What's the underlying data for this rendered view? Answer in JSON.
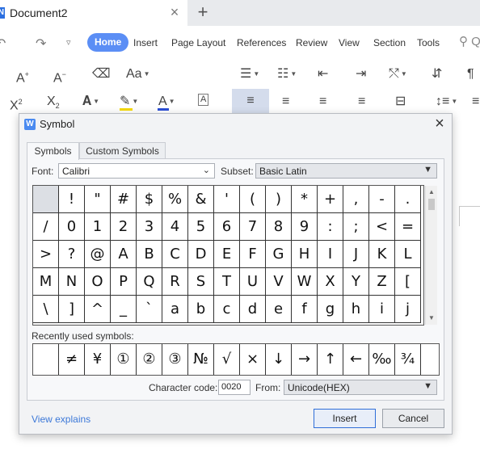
{
  "window": {
    "tab_title": "Document2",
    "tab_close_glyph": "×",
    "new_tab_glyph": "+"
  },
  "menu": {
    "items": [
      "Home",
      "Insert",
      "Page Layout",
      "References",
      "Review",
      "View",
      "Section",
      "Tools"
    ],
    "active": "Home",
    "search_glyph": "Q"
  },
  "toolbar": {
    "row1": [
      {
        "name": "increase-font-size-icon",
        "glyph": "A⁺"
      },
      {
        "name": "decrease-font-size-icon",
        "glyph": "A⁻"
      },
      {
        "name": "clear-format-icon",
        "glyph": "⌫"
      },
      {
        "name": "change-case-icon",
        "glyph": "Aa"
      },
      {
        "name": "bullets-icon",
        "glyph": "☰"
      },
      {
        "name": "numbering-icon",
        "glyph": "☷"
      },
      {
        "name": "decrease-indent-icon",
        "glyph": "⇤"
      },
      {
        "name": "increase-indent-icon",
        "glyph": "⇥"
      },
      {
        "name": "sort-icon",
        "glyph": "⇵"
      },
      {
        "name": "paragraph-mark-icon",
        "glyph": "¶"
      }
    ],
    "row2": [
      {
        "name": "superscript-icon",
        "glyph": "X²"
      },
      {
        "name": "subscript-icon",
        "glyph": "X₂"
      },
      {
        "name": "text-effect-icon",
        "glyph": "A"
      },
      {
        "name": "highlight-icon",
        "glyph": "✎"
      },
      {
        "name": "font-color-icon",
        "glyph": "A"
      },
      {
        "name": "character-border-icon",
        "glyph": "A"
      },
      {
        "name": "align-left-icon",
        "glyph": "≡"
      },
      {
        "name": "align-center-icon",
        "glyph": "≡"
      },
      {
        "name": "align-right-icon",
        "glyph": "≡"
      },
      {
        "name": "justify-icon",
        "glyph": "≡"
      },
      {
        "name": "distributed-icon",
        "glyph": "⊟"
      },
      {
        "name": "line-spacing-icon",
        "glyph": "↕≡"
      }
    ],
    "colors": {
      "highlight": "#f5d800",
      "font_color": "#2b4fd6"
    }
  },
  "dialog": {
    "title": "Symbol",
    "icon_letter": "W",
    "close_glyph": "×",
    "tabs": [
      "Symbols",
      "Custom Symbols"
    ],
    "font_label": "Font:",
    "font_value": "Calibri",
    "subset_label": "Subset:",
    "subset_value": "Basic Latin",
    "grid": [
      [
        "",
        "!",
        "\"",
        "#",
        "$",
        "%",
        "&",
        "'",
        "(",
        ")",
        "*",
        "+",
        ",",
        "-",
        "."
      ],
      [
        "/",
        "0",
        "1",
        "2",
        "3",
        "4",
        "5",
        "6",
        "7",
        "8",
        "9",
        ":",
        ";",
        "<",
        "="
      ],
      [
        ">",
        "?",
        "@",
        "A",
        "B",
        "C",
        "D",
        "E",
        "F",
        "G",
        "H",
        "I",
        "J",
        "K",
        "L"
      ],
      [
        "M",
        "N",
        "O",
        "P",
        "Q",
        "R",
        "S",
        "T",
        "U",
        "V",
        "W",
        "X",
        "Y",
        "Z",
        "["
      ],
      [
        "\\",
        "]",
        "^",
        "_",
        "`",
        "a",
        "b",
        "c",
        "d",
        "e",
        "f",
        "g",
        "h",
        "i",
        "j"
      ]
    ],
    "recent_label": "Recently used symbols:",
    "recent": [
      "",
      "≠",
      "¥",
      "①",
      "②",
      "③",
      "№",
      "√",
      "×",
      "↓",
      "→",
      "↑",
      "←",
      "‰",
      "¾"
    ],
    "char_code_label": "Character code:",
    "char_code_value": "0020",
    "from_label": "From:",
    "from_value": "Unicode(HEX)",
    "view_explains": "View explains",
    "insert_label": "Insert",
    "cancel_label": "Cancel"
  }
}
